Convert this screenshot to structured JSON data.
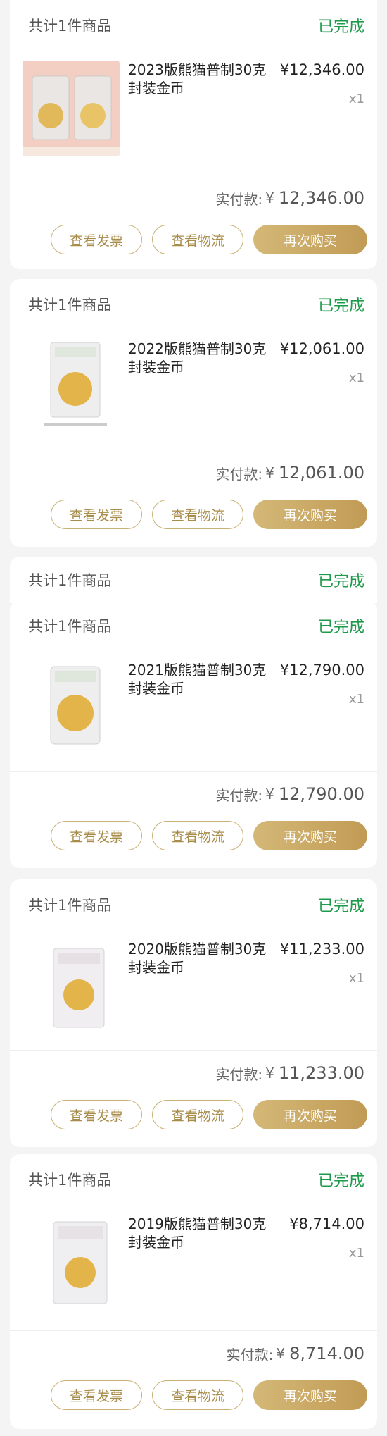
{
  "orders": [
    {
      "count": "共计1件商品",
      "status": "已完成",
      "name_line1": "2023版熊猫普制30克",
      "name_line2": "封装金币",
      "price": "¥12,346.00",
      "qty": "x1",
      "paid_label": "实付款:",
      "paid_yen": "¥",
      "paid_amount": "12,346.00",
      "btn_invoice": "查看发票",
      "btn_logistics": "查看物流",
      "btn_rebuy": "再次购买"
    },
    {
      "count": "共计1件商品",
      "status": "已完成",
      "name_line1": "2022版熊猫普制30克",
      "name_line2": "封装金币",
      "price": "¥12,061.00",
      "qty": "x1",
      "paid_label": "实付款:",
      "paid_yen": "¥",
      "paid_amount": "12,061.00",
      "btn_invoice": "查看发票",
      "btn_logistics": "查看物流",
      "btn_rebuy": "再次购买"
    },
    {
      "count": "共计1件商品",
      "status": "已完成",
      "name_line1": "2021版熊猫普制30克",
      "name_line2": "封装金币",
      "price": "¥12,790.00",
      "qty": "x1",
      "paid_label": "实付款:",
      "paid_yen": "¥",
      "paid_amount": "12,790.00",
      "btn_invoice": "查看发票",
      "btn_logistics": "查看物流",
      "btn_rebuy": "再次购买"
    },
    {
      "count": "共计1件商品",
      "status": "已完成",
      "name_line1": "2020版熊猫普制30克",
      "name_line2": "封装金币",
      "price": "¥11,233.00",
      "qty": "x1",
      "paid_label": "实付款:",
      "paid_yen": "¥",
      "paid_amount": "11,233.00",
      "btn_invoice": "查看发票",
      "btn_logistics": "查看物流",
      "btn_rebuy": "再次购买"
    },
    {
      "count": "共计1件商品",
      "status": "已完成",
      "name_line1": "2019版熊猫普制30克",
      "name_line2": "封装金币",
      "price": "¥8,714.00",
      "qty": "x1",
      "paid_label": "实付款:",
      "paid_yen": "¥",
      "paid_amount": "8,714.00",
      "btn_invoice": "查看发票",
      "btn_logistics": "查看物流",
      "btn_rebuy": "再次购买"
    }
  ],
  "peek": {
    "count": "共计1件商品",
    "status": "已完成"
  },
  "colors": {
    "status_green": "#1e9a4b",
    "gold": "#c19b55",
    "background": "#f4f4f4"
  }
}
